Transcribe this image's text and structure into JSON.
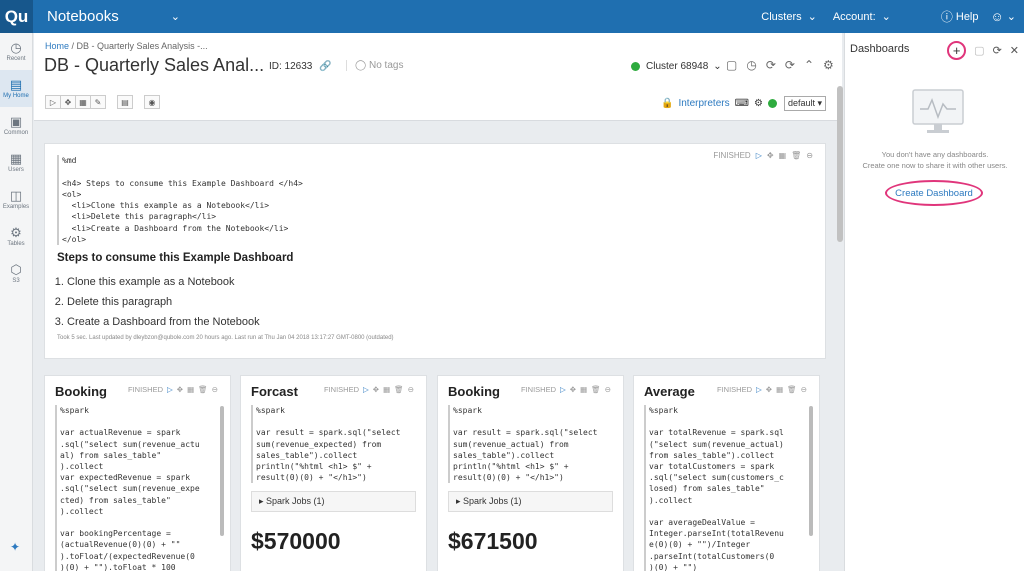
{
  "topbar": {
    "logo": "Qu",
    "app_name": "Notebooks",
    "clusters": "Clusters",
    "account": "Account:",
    "help": "Help"
  },
  "sidebar": {
    "items": [
      {
        "label": "Recent",
        "icon": "clock-icon"
      },
      {
        "label": "My Home",
        "icon": "home-icon"
      },
      {
        "label": "Common",
        "icon": "folder-icon"
      },
      {
        "label": "Users",
        "icon": "users-icon"
      },
      {
        "label": "Examples",
        "icon": "examples-icon"
      },
      {
        "label": "Tables",
        "icon": "tables-icon"
      },
      {
        "label": "S3",
        "icon": "cube-icon"
      }
    ]
  },
  "header": {
    "breadcrumb_home": "Home",
    "breadcrumb_current": "DB - Quarterly Sales Analysis -...",
    "title": "DB - Quarterly Sales Anal...",
    "id": "ID: 12633",
    "tags": "No tags",
    "cluster": "Cluster 68948",
    "interpreters": "Interpreters",
    "default_select": "default"
  },
  "paragraph": {
    "status": "FINISHED",
    "code_lines": [
      "%md",
      "",
      "<h4> Steps to consume this Example Dashboard </h4>",
      "<ol>",
      "  <li>Clone this example as a Notebook</li>",
      "  <li>Delete this paragraph</li>",
      "  <li>Create a Dashboard from the Notebook</li>",
      "</ol>"
    ],
    "output_heading": "Steps to consume this Example Dashboard",
    "output_list": [
      "Clone this example as a Notebook",
      "Delete this paragraph",
      "Create a Dashboard from the Notebook"
    ],
    "footer": "Took 5 sec. Last updated by dleybzon@qubole.com 20 hours ago. Last run at Thu Jan 04 2018 13:17:27 GMT-0800 (outdated)"
  },
  "cards": [
    {
      "title": "Booking",
      "status": "FINISHED",
      "code": "%spark\n\nvar actualRevenue = spark\n.sql(\"select sum(revenue_actu\nal) from sales_table\"\n).collect\nvar expectedRevenue = spark\n.sql(\"select sum(revenue_expe\ncted) from sales_table\"\n).collect\n\nvar bookingPercentage =\n(actualRevenue(0)(0) + \"\"\n).toFloat/(expectedRevenue(0\n)(0) + \"\").toFloat * 100",
      "jobs": "",
      "value": ""
    },
    {
      "title": "Forcast",
      "status": "FINISHED",
      "code": "%spark\n\nvar result = spark.sql(\"select\nsum(revenue_expected) from\nsales_table\").collect\nprintln(\"%html <h1> $\" +\nresult(0)(0) + \"</h1>\")",
      "jobs": "Spark Jobs (1)",
      "value": "$570000"
    },
    {
      "title": "Booking",
      "status": "FINISHED",
      "code": "%spark\n\nvar result = spark.sql(\"select\nsum(revenue_actual) from\nsales_table\").collect\nprintln(\"%html <h1> $\" +\nresult(0)(0) + \"</h1>\")",
      "jobs": "Spark Jobs (1)",
      "value": "$671500"
    },
    {
      "title": "Average",
      "status": "FINISHED",
      "code": "%spark\n\nvar totalRevenue = spark.sql\n(\"select sum(revenue_actual)\nfrom sales_table\").collect\nvar totalCustomers = spark\n.sql(\"select sum(customers_c\nlosed) from sales_table\"\n).collect\n\nvar averageDealValue =\nInteger.parseInt(totalRevenu\ne(0)(0) + \"\")/Integer\n.parseInt(totalCustomers(0\n)(0) + \"\")",
      "jobs": "",
      "value": ""
    }
  ],
  "panel": {
    "title": "Dashboards",
    "message_1": "You don't have any dashboards.",
    "message_2": "Create one now to share it with other users.",
    "create_button": "Create Dashboard"
  },
  "colors": {
    "topbar": "#1f6fb0",
    "accent": "#2d7ac0",
    "highlight": "#e0357b",
    "running": "#2eab3e"
  }
}
